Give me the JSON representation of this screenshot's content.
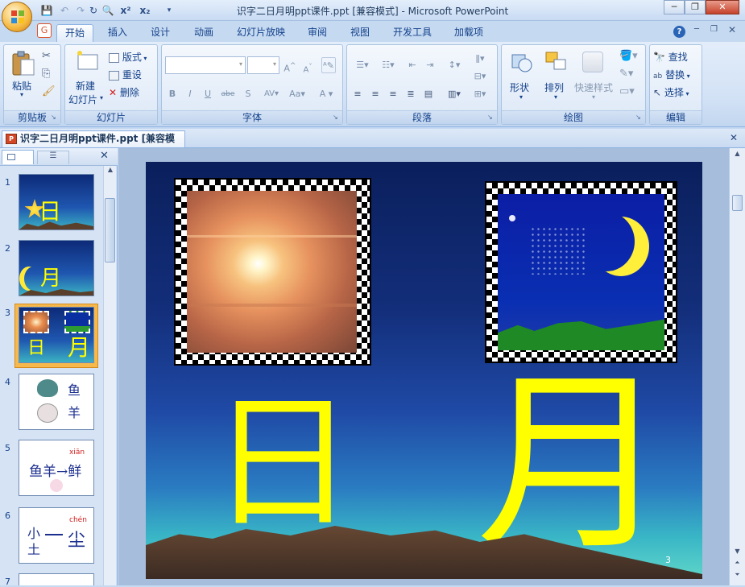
{
  "window": {
    "title": "识字二日月明ppt课件.ppt [兼容模式] - Microsoft PowerPoint"
  },
  "tabs": [
    "开始",
    "插入",
    "设计",
    "动画",
    "幻灯片放映",
    "审阅",
    "视图",
    "开发工具",
    "加载项"
  ],
  "ribbon": {
    "clipboard": {
      "label": "剪贴板",
      "paste": "粘贴"
    },
    "slides": {
      "label": "幻灯片",
      "new_slide_1": "新建",
      "new_slide_2": "幻灯片",
      "layout": "版式",
      "reset": "重设",
      "delete": "删除"
    },
    "font": {
      "label": "字体"
    },
    "paragraph": {
      "label": "段落"
    },
    "drawing": {
      "label": "绘图",
      "shapes": "形状",
      "arrange": "排列",
      "quick_styles": "快速样式"
    },
    "editing": {
      "label": "编辑",
      "find": "查找",
      "replace": "替换",
      "select": "选择"
    }
  },
  "document_tab": "识字二日月明ppt课件.ppt [兼容模式]",
  "thumbnails": [
    {
      "num": "1",
      "chars": "日"
    },
    {
      "num": "2",
      "chars": "月"
    },
    {
      "num": "3",
      "chars_left": "日",
      "chars_right": "月"
    },
    {
      "num": "4",
      "line1": "鱼",
      "line2": "羊"
    },
    {
      "num": "5",
      "pinyin": "xiān",
      "text": "鱼羊→鲜"
    },
    {
      "num": "6",
      "pinyin": "chén",
      "text_left_top": "小",
      "text_left_bottom": "土",
      "text_right": "尘"
    },
    {
      "num": "7"
    }
  ],
  "slide": {
    "char_sun": "日",
    "char_moon": "月",
    "page_number": "3"
  },
  "colors": {
    "accent_yellow": "#ffff00",
    "ribbon_blue": "#15428b",
    "selected_thumb": "#f7b94b"
  }
}
